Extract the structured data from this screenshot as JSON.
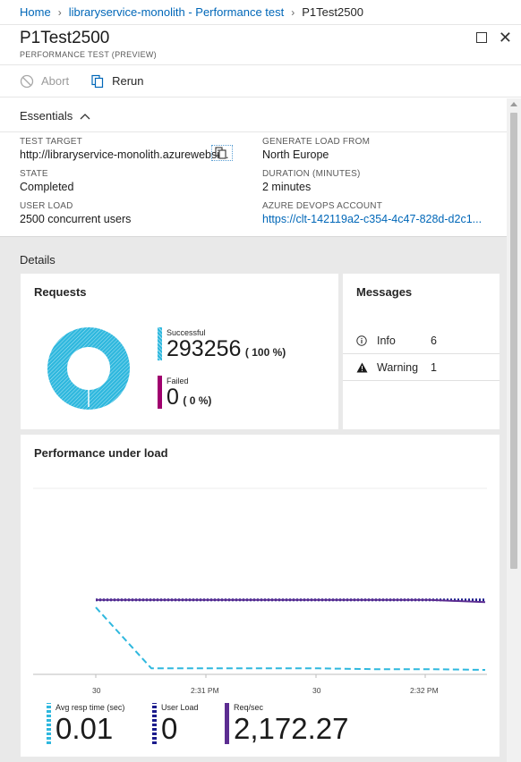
{
  "breadcrumb": {
    "home": "Home",
    "parent": "libraryservice-monolith - Performance test",
    "current": "P1Test2500"
  },
  "header": {
    "title": "P1Test2500",
    "subtitle": "PERFORMANCE TEST (PREVIEW)"
  },
  "toolbar": {
    "abort_label": "Abort",
    "rerun_label": "Rerun"
  },
  "essentials": {
    "label": "Essentials",
    "test_target_label": "TEST TARGET",
    "test_target_value": "http://libraryservice-monolith.azurewebsi...",
    "generate_load_label": "GENERATE LOAD FROM",
    "generate_load_value": "North Europe",
    "state_label": "STATE",
    "state_value": "Completed",
    "duration_label": "DURATION (MINUTES)",
    "duration_value": "2 minutes",
    "user_load_label": "USER LOAD",
    "user_load_value": "2500 concurrent users",
    "devops_label": "AZURE DEVOPS ACCOUNT",
    "devops_value": "https://clt-142119a2-c354-4c47-828d-d2c1..."
  },
  "details": {
    "label": "Details",
    "requests": {
      "title": "Requests",
      "successful_label": "Successful",
      "successful_value": "293256",
      "successful_pct": "( 100 %)",
      "failed_label": "Failed",
      "failed_value": "0",
      "failed_pct": "( 0 %)",
      "success_color": "#2fb8de",
      "failed_color": "#a0006e"
    },
    "messages": {
      "title": "Messages",
      "items": [
        {
          "icon": "info-icon",
          "label": "Info",
          "count": "6"
        },
        {
          "icon": "warning-icon",
          "label": "Warning",
          "count": "1"
        }
      ]
    },
    "performance": {
      "title": "Performance under load",
      "x_ticks": [
        "30",
        "2:31 PM",
        "30",
        "2:32 PM"
      ],
      "metrics": [
        {
          "label": "Avg resp time (sec)",
          "value": "0.01",
          "color": "#2fb8de"
        },
        {
          "label": "User Load",
          "value": "0",
          "color": "#1b1b8c"
        },
        {
          "label": "Req/sec",
          "value": "2,172.27",
          "color": "#5c2d91"
        }
      ]
    }
  },
  "chart_data": {
    "type": "line",
    "x": [
      0,
      1,
      2,
      3,
      4,
      5,
      6,
      7
    ],
    "x_tick_labels": [
      "30",
      "2:31 PM",
      "30",
      "2:32 PM"
    ],
    "series": [
      {
        "name": "Avg resp time (sec)",
        "style": "dashed",
        "color": "#2fb8de",
        "values": [
          0.9,
          0.08,
          0.08,
          0.08,
          0.08,
          0.07,
          0.07,
          0.06
        ]
      },
      {
        "name": "User Load",
        "style": "dotted",
        "color": "#1b1b8c",
        "values": [
          1.0,
          1.0,
          1.0,
          1.0,
          1.0,
          1.0,
          1.0,
          1.0
        ]
      },
      {
        "name": "Req/sec",
        "style": "solid",
        "color": "#5c2d91",
        "values": [
          1.0,
          1.0,
          1.0,
          1.0,
          1.0,
          1.0,
          1.0,
          0.97
        ]
      }
    ],
    "ylim": [
      0,
      2.5
    ],
    "grid": true,
    "xlabel": "",
    "ylabel": ""
  }
}
